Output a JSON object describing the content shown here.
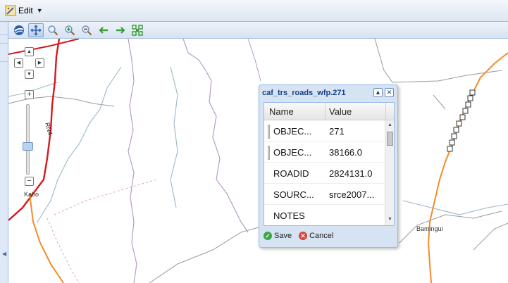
{
  "menu": {
    "edit_label": "Edit",
    "edit_icon": "pencil-ruler-icon"
  },
  "toolbar": {
    "buttons": [
      {
        "name": "globe-icon",
        "active": false
      },
      {
        "name": "pan-icon",
        "active": true
      },
      {
        "name": "zoom-in-icon",
        "active": false
      },
      {
        "name": "zoom-in-box-icon",
        "active": false
      },
      {
        "name": "zoom-out-box-icon",
        "active": false
      },
      {
        "name": "back-arrow-icon",
        "active": false
      },
      {
        "name": "forward-arrow-icon",
        "active": false
      },
      {
        "name": "full-extent-icon",
        "active": false
      }
    ]
  },
  "map": {
    "labels": {
      "kabo": "Kabo",
      "bamingui": "Bamingui",
      "road": "RN4"
    },
    "colors": {
      "road_red": "#d7191c",
      "road_orange": "#f28c28",
      "river": "#9bb8c8",
      "boundary": "#b79cc8"
    }
  },
  "popup": {
    "title": "caf_trs_roads_wfp.271",
    "columns": {
      "name": "Name",
      "value": "Value"
    },
    "rows": [
      {
        "name": "OBJEC...",
        "value": "271"
      },
      {
        "name": "OBJEC...",
        "value": "38166.0"
      },
      {
        "name": "ROADID",
        "value": "2824131.0"
      },
      {
        "name": "SOURC...",
        "value": "srce2007..."
      },
      {
        "name": "NOTES",
        "value": ""
      }
    ],
    "save_label": "Save",
    "cancel_label": "Cancel",
    "accent": "#15428b"
  }
}
